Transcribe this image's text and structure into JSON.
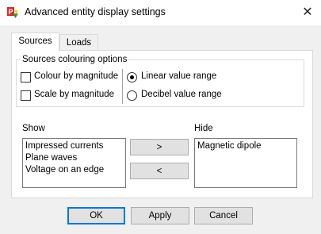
{
  "window": {
    "title": "Advanced entity display settings",
    "icon": "app-logo-icon",
    "close_glyph": "✕"
  },
  "tabs": [
    {
      "label": "Sources",
      "active": true
    },
    {
      "label": "Loads",
      "active": false
    }
  ],
  "colouring": {
    "legend": "Sources colouring options",
    "colour_by_magnitude": {
      "label": "Colour by magnitude",
      "checked": false
    },
    "scale_by_magnitude": {
      "label": "Scale by magnitude",
      "checked": false
    },
    "linear_value_range": {
      "label": "Linear value range",
      "selected": true
    },
    "decibel_value_range": {
      "label": "Decibel value range",
      "selected": false
    }
  },
  "show": {
    "label": "Show",
    "items": [
      "Impressed currents",
      "Plane waves",
      "Voltage on an edge"
    ]
  },
  "hide": {
    "label": "Hide",
    "items": [
      "Magnetic dipole"
    ]
  },
  "move_buttons": {
    "to_hide": ">",
    "to_show": "<"
  },
  "footer": {
    "ok": "OK",
    "apply": "Apply",
    "cancel": "Cancel"
  }
}
